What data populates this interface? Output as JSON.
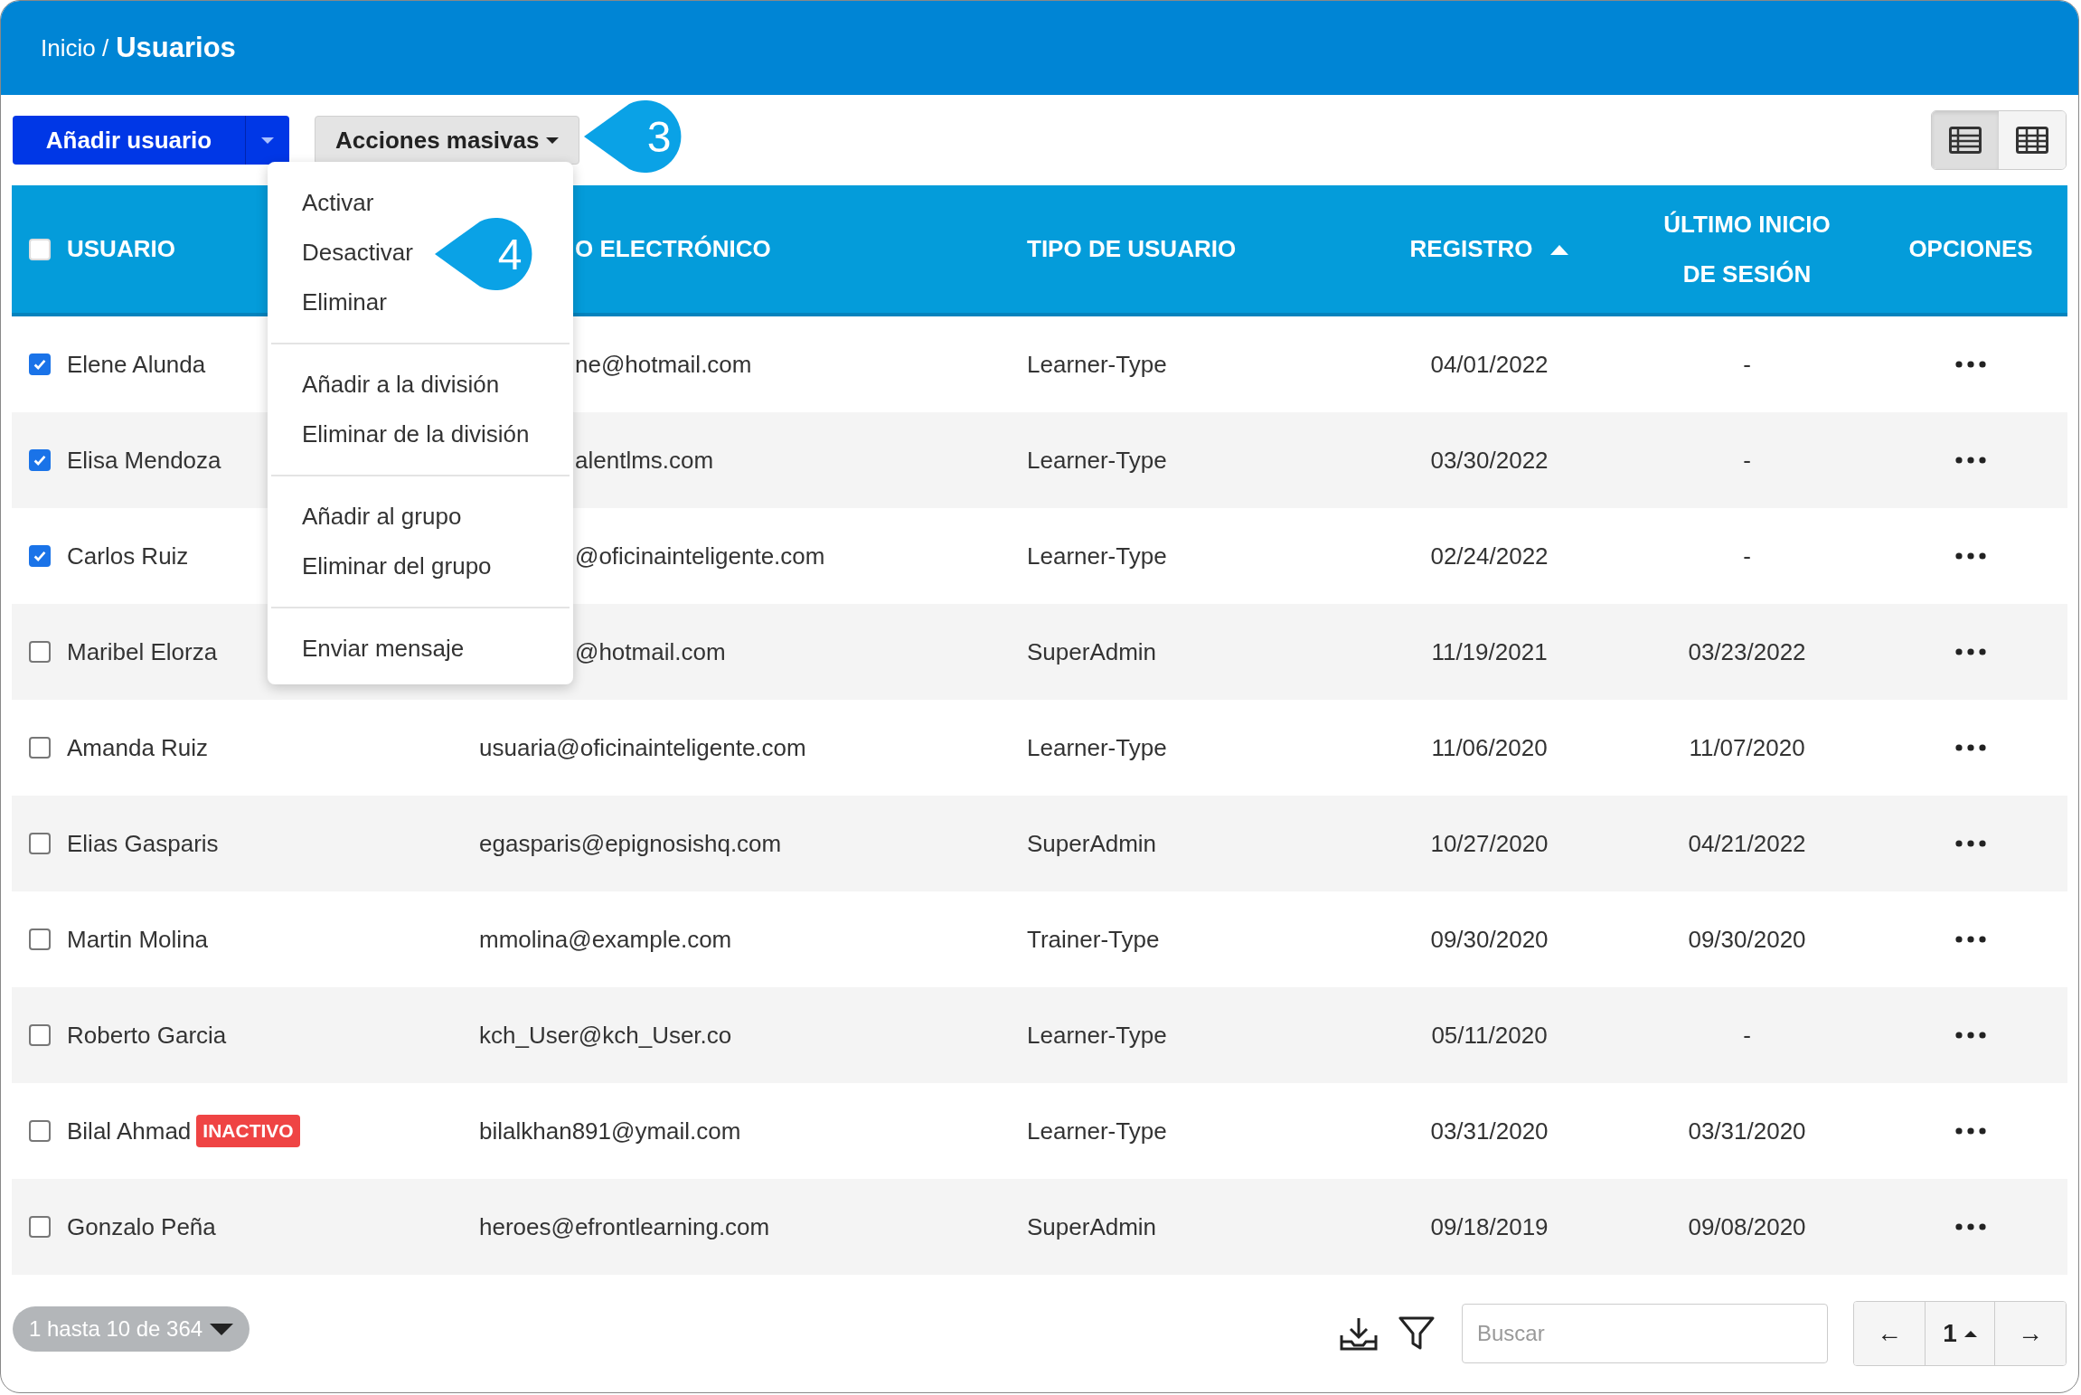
{
  "breadcrumb": {
    "parent": "Inicio /",
    "current": "Usuarios"
  },
  "toolbar": {
    "add_button": "Añadir usuario",
    "bulk_button": "Acciones masivas",
    "views": [
      {
        "kind": "list",
        "selected": true
      },
      {
        "kind": "grid",
        "selected": false
      }
    ]
  },
  "bulk_menu": {
    "groups": [
      [
        "Activar",
        "Desactivar",
        "Eliminar"
      ],
      [
        "Añadir a la división",
        "Eliminar de la división"
      ],
      [
        "Añadir al grupo",
        "Eliminar del grupo"
      ],
      [
        "Enviar mensaje"
      ]
    ]
  },
  "callouts": [
    {
      "number": "3",
      "kind": "toolbar"
    },
    {
      "number": "4",
      "kind": "menu"
    }
  ],
  "table": {
    "select_all": {
      "checked": false
    },
    "columns": [
      {
        "label": "USUARIO",
        "kind": "user"
      },
      {
        "label": "O ELECTRÓNICO",
        "kind": "email",
        "covered_by_menu": true
      },
      {
        "label": "TIPO DE USUARIO",
        "kind": "type"
      },
      {
        "label": "REGISTRO",
        "kind": "date",
        "sorted": true
      },
      {
        "label": "ÚLTIMO INICIO DE SESIÓN",
        "kind": "date"
      },
      {
        "label": "OPCIONES",
        "kind": "options"
      }
    ],
    "rows": [
      {
        "selected": true,
        "name": "Elene Alunda",
        "email": "ne@hotmail.com",
        "covered_by_menu": true,
        "type": "Learner-Type",
        "registered": "04/01/2022",
        "last_login": "-"
      },
      {
        "selected": true,
        "name": "Elisa Mendoza",
        "email": "alentlms.com",
        "covered_by_menu": true,
        "type": "Learner-Type",
        "registered": "03/30/2022",
        "last_login": "-"
      },
      {
        "selected": true,
        "name": "Carlos Ruiz",
        "email": "@oficinainteligente.com",
        "covered_by_menu": true,
        "type": "Learner-Type",
        "registered": "02/24/2022",
        "last_login": "-"
      },
      {
        "selected": false,
        "name": "Maribel Elorza",
        "email": "@hotmail.com",
        "covered_by_menu": true,
        "type": "SuperAdmin",
        "registered": "11/19/2021",
        "last_login": "03/23/2022"
      },
      {
        "selected": false,
        "name": "Amanda Ruiz",
        "email": "usuaria@oficinainteligente.com",
        "type": "Learner-Type",
        "registered": "11/06/2020",
        "last_login": "11/07/2020"
      },
      {
        "selected": false,
        "name": "Elias Gasparis",
        "email": "egasparis@epignosishq.com",
        "type": "SuperAdmin",
        "registered": "10/27/2020",
        "last_login": "04/21/2022"
      },
      {
        "selected": false,
        "name": "Martin Molina",
        "email": "mmolina@example.com",
        "type": "Trainer-Type",
        "registered": "09/30/2020",
        "last_login": "09/30/2020"
      },
      {
        "selected": false,
        "name": "Roberto Garcia",
        "email": "kch_User@kch_User.co",
        "type": "Learner-Type",
        "registered": "05/11/2020",
        "last_login": "-"
      },
      {
        "selected": false,
        "name": "Bilal Ahmad",
        "badge": "INACTIVO",
        "email": "bilalkhan891@ymail.com",
        "type": "Learner-Type",
        "registered": "03/31/2020",
        "last_login": "03/31/2020"
      },
      {
        "selected": false,
        "name": "Gonzalo Peña",
        "email": "heroes@efrontlearning.com",
        "type": "SuperAdmin",
        "registered": "09/18/2019",
        "last_login": "09/08/2020"
      }
    ]
  },
  "footer": {
    "range": "1 hasta 10 de 364",
    "search": {
      "placeholder": "Buscar"
    },
    "pager": {
      "prev": "←",
      "page": "1",
      "next": "→"
    }
  }
}
